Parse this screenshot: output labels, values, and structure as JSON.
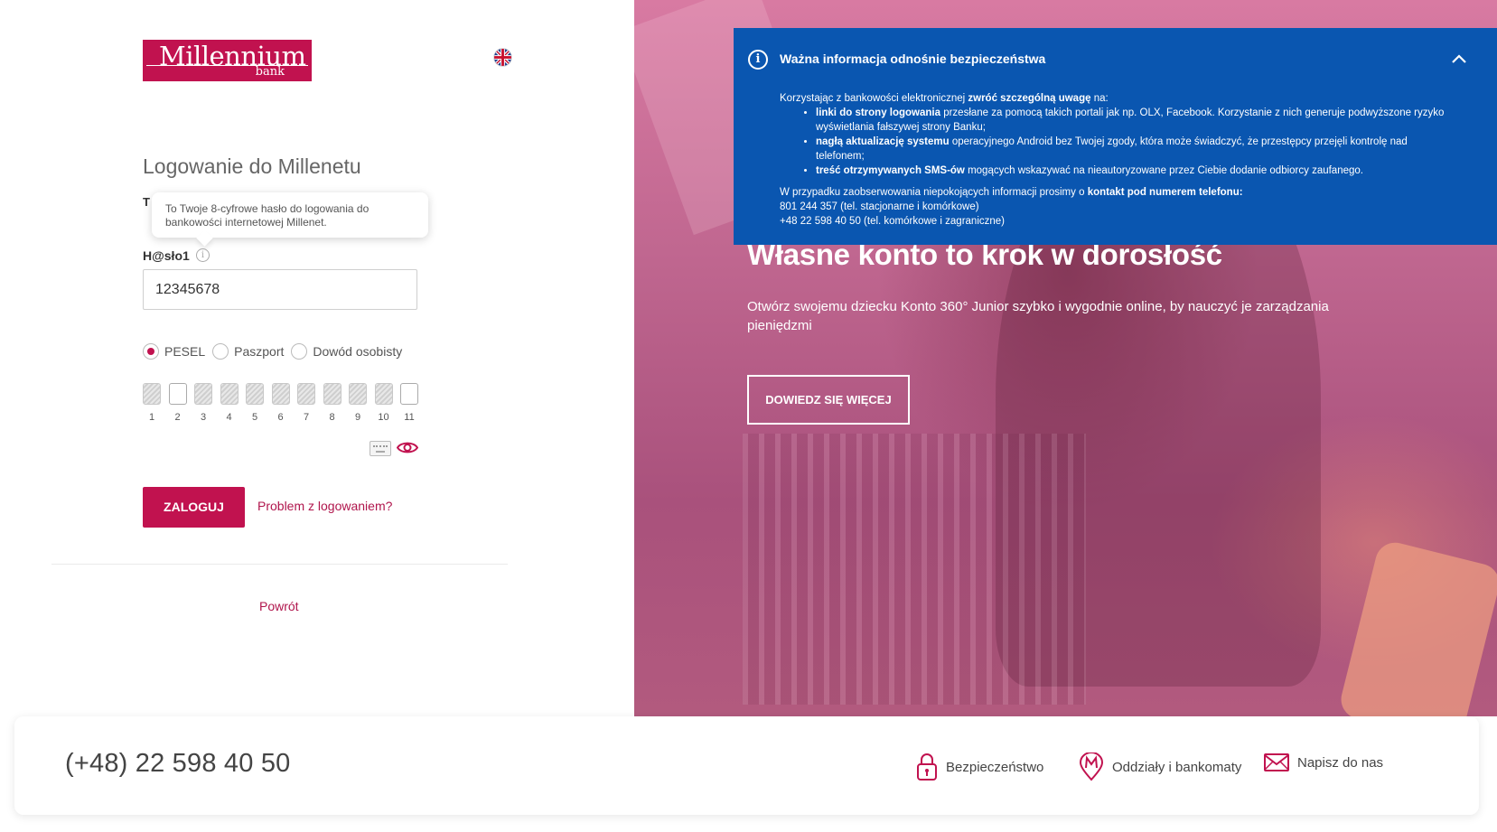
{
  "brand": {
    "name": "Millennium",
    "sub": "bank"
  },
  "login": {
    "title": "Logowanie do Millenetu",
    "hidden_label_start": "T",
    "tooltip": "To Twoje 8-cyfrowe hasło do logowania do bankowości internetowej Millenet.",
    "password_label": "H@sło1",
    "password_value": "12345678",
    "id_types": [
      "PESEL",
      "Paszport",
      "Dowód osobisty"
    ],
    "id_selected": "PESEL",
    "digit_numbers": [
      "1",
      "2",
      "3",
      "4",
      "5",
      "6",
      "7",
      "8",
      "9",
      "10",
      "11"
    ],
    "submit_label": "ZALOGUJ",
    "problem_link": "Problem z logowaniem?",
    "back_link": "Powrót"
  },
  "hero": {
    "title": "Własne konto to krok w dorosłość",
    "description": "Otwórz swojemu dziecku Konto 360° Junior szybko i wygodnie online, by nauczyć je zarządzania pieniędzmi",
    "button": "DOWIEDZ SIĘ WIĘCEJ"
  },
  "notice": {
    "title": "Ważna informacja odnośnie bezpieczeństwa",
    "intro_a": "Korzystając z bankowości elektronicznej ",
    "intro_b": "zwróć szczególną uwagę",
    "intro_c": " na:",
    "items": [
      {
        "bold": "linki do strony logowania",
        "text": " przesłane za pomocą takich portali jak np. OLX, Facebook. Korzystanie z nich generuje podwyższone ryzyko wyświetlania fałszywej strony Banku;"
      },
      {
        "bold": "nagłą aktualizację systemu",
        "text": " operacyjnego Android bez Twojej zgody, która może świadczyć, że przestępcy przejęli kontrolę nad telefonem;"
      },
      {
        "bold": "treść otrzymywanych SMS-ów",
        "text": " mogących wskazywać na nieautoryzowane przez Ciebie dodanie odbiorcy zaufanego."
      }
    ],
    "outro_a": "W przypadku zaobserwowania niepokojących informacji prosimy o ",
    "outro_b": "kontakt pod numerem telefonu:",
    "phone1": "801 244 357 (tel. stacjonarne i komórkowe)",
    "phone2": "+48 22 598 40 50 (tel. komórkowe i zagraniczne)"
  },
  "footer": {
    "phone": "(+48) 22 598 40 50",
    "links": [
      "Bezpieczeństwo",
      "Oddziały i bankomaty",
      "Napisz do nas"
    ]
  },
  "colors": {
    "brand": "#c1124f",
    "notice_bg": "#0a56b0"
  }
}
